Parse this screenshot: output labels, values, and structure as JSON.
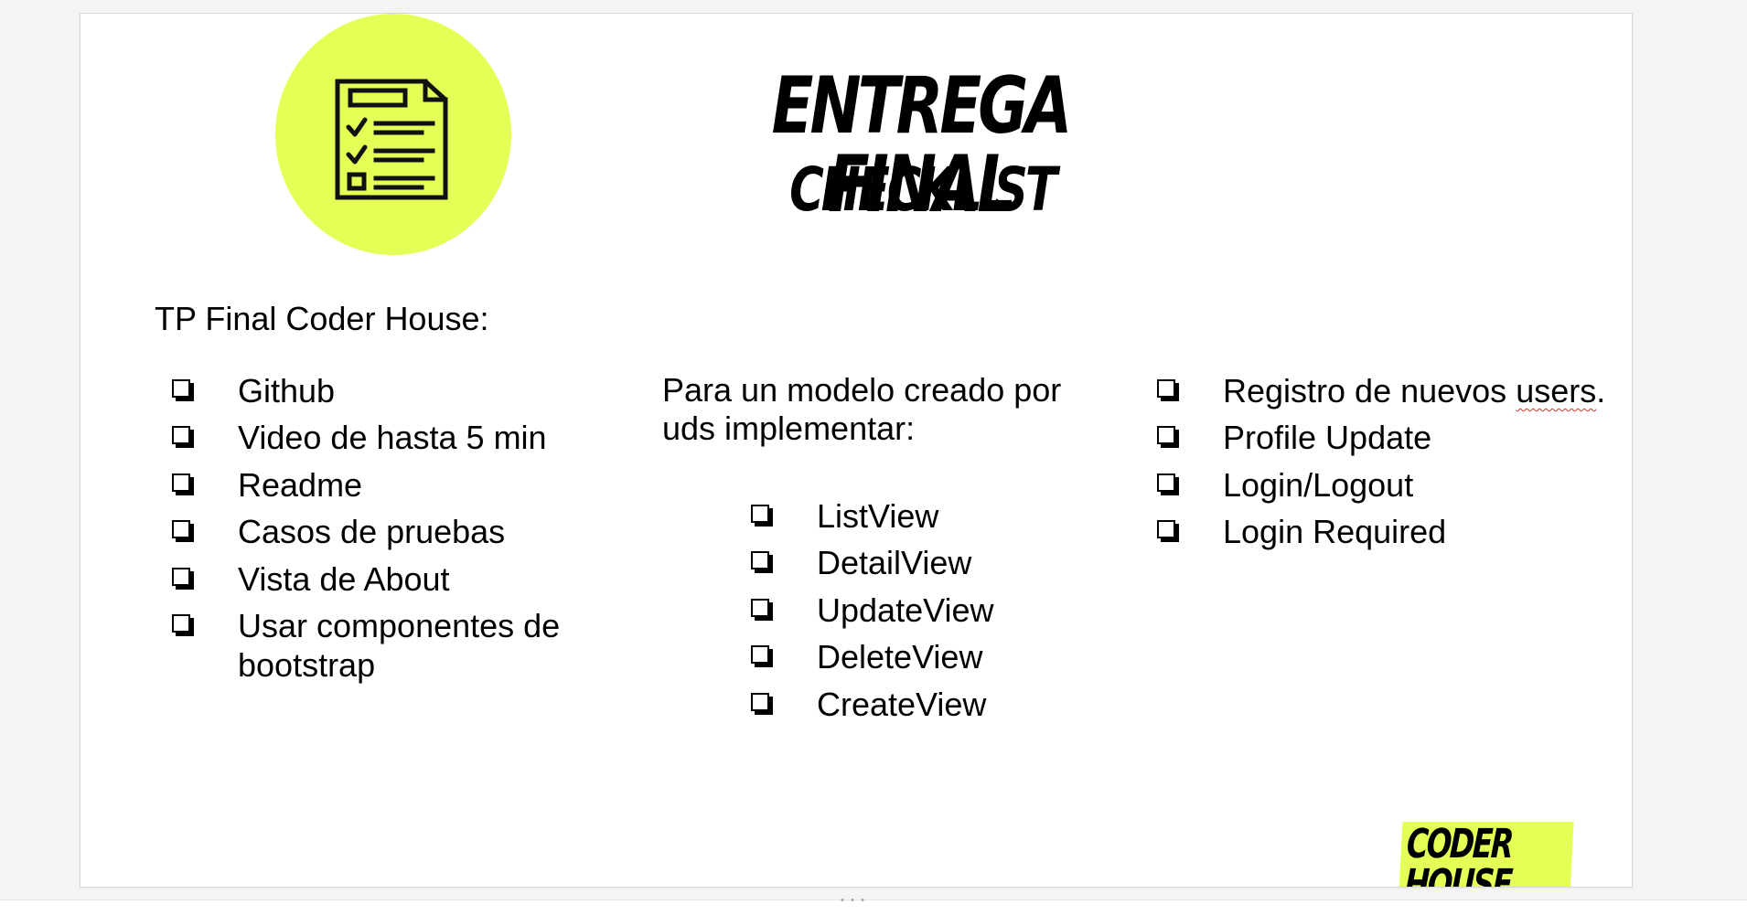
{
  "colors": {
    "accent": "#e6ff57",
    "text": "#000000",
    "slide_background": "#ffffff",
    "spellcheck_underline": "#d93025"
  },
  "slide": {
    "icon": "checklist-document-icon",
    "title": "ENTREGA FINAL",
    "subtitle": "CHECKLIST",
    "intro": "TP Final Coder House:",
    "list_left": [
      "Github",
      "Video de hasta 5 min",
      "Readme",
      "Casos de pruebas",
      "Vista de About",
      "Usar componentes de bootstrap"
    ],
    "middle_paragraph": "Para un modelo creado por uds implementar:",
    "list_middle": [
      "ListView",
      "DetailView",
      "UpdateView",
      "DeleteView",
      "CreateView"
    ],
    "list_right": {
      "first_prefix": "Registro de nuevos ",
      "first_underlined": "users",
      "first_suffix": ".",
      "others": [
        "Profile Update",
        "Login/Logout",
        "Login Required"
      ]
    },
    "brand": "CODER HOUSE"
  },
  "checkbox_icon": "square-checkbox-icon"
}
